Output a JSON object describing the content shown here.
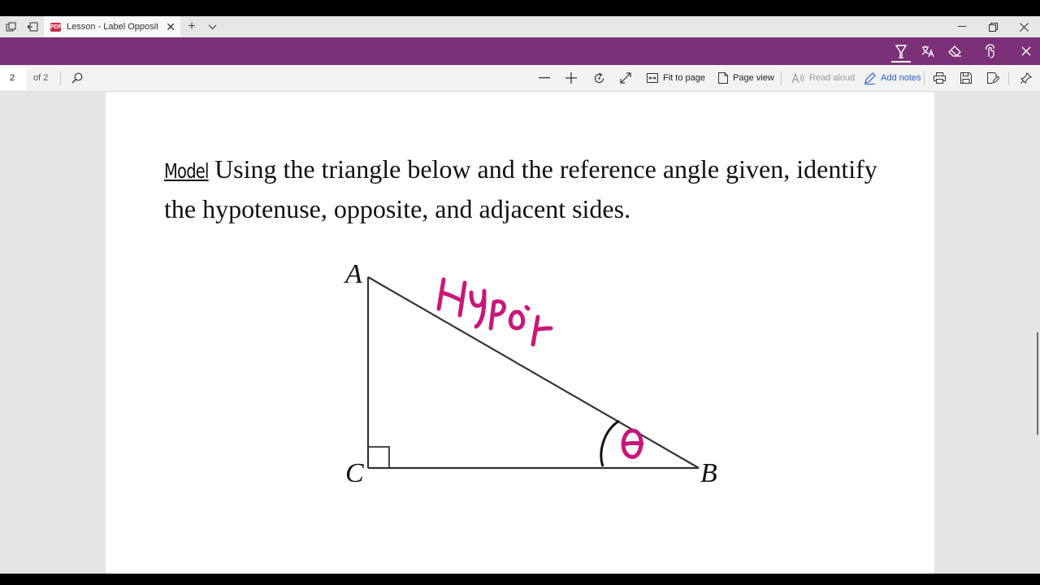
{
  "browser": {
    "tab_title": "Lesson - Label Opposite",
    "tab_favicon": "pdf-icon",
    "new_tab_icon": "plus-icon",
    "tab_list_icon": "chevron-down-icon",
    "window_controls": [
      "minimize-icon",
      "restore-icon",
      "close-icon"
    ]
  },
  "ink_toolbar": {
    "tools": [
      "highlighter-icon",
      "translate-icon",
      "eraser-icon",
      "touch-write-icon",
      "close-icon"
    ],
    "accent_color": "#7b3177",
    "active_tool": "highlighter-icon"
  },
  "pdf_toolbar": {
    "current_page": "2",
    "page_count_label": "of 2",
    "fit_to_page_label": "Fit to page",
    "page_view_label": "Page view",
    "read_aloud_label": "Read aloud",
    "add_notes_label": "Add notes"
  },
  "document": {
    "model_label": "Model",
    "problem_text": "Using the triangle below and the reference angle given, identify the hypotenuse, opposite, and adjacent sides.",
    "vertices": {
      "a": "A",
      "b": "B",
      "c": "C"
    },
    "ink_color": "#c8177a",
    "ink_annotations": {
      "hypotenuse_label": "Hypo'l",
      "angle_label": "θ"
    }
  }
}
